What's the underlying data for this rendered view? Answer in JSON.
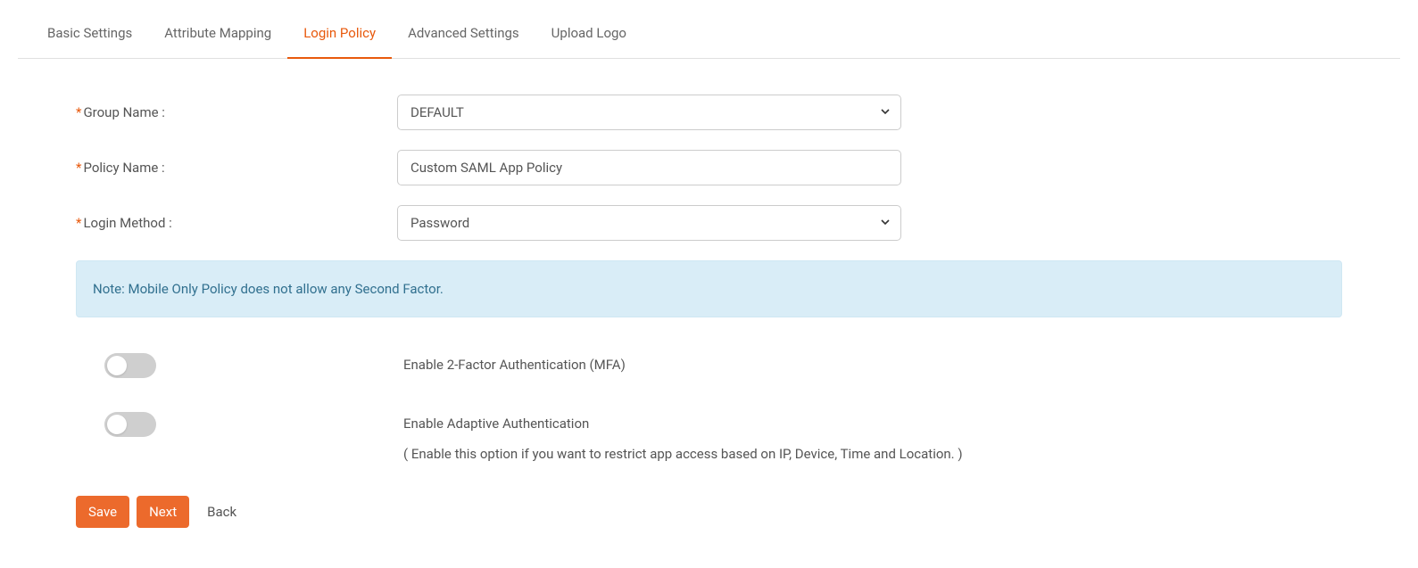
{
  "tabs": [
    {
      "label": "Basic Settings",
      "active": false
    },
    {
      "label": "Attribute Mapping",
      "active": false
    },
    {
      "label": "Login Policy",
      "active": true
    },
    {
      "label": "Advanced Settings",
      "active": false
    },
    {
      "label": "Upload Logo",
      "active": false
    }
  ],
  "form": {
    "group_name": {
      "label": "Group Name :",
      "value": "DEFAULT"
    },
    "policy_name": {
      "label": "Policy Name :",
      "value": "Custom SAML App Policy"
    },
    "login_method": {
      "label": "Login Method :",
      "value": "Password"
    }
  },
  "note": "Note: Mobile Only Policy does not allow any Second Factor.",
  "toggles": {
    "mfa": {
      "label": "Enable 2-Factor Authentication (MFA)"
    },
    "adaptive": {
      "label": "Enable Adaptive Authentication",
      "sublabel": "( Enable this option if you want to restrict app access based on IP, Device, Time and Location. )"
    }
  },
  "buttons": {
    "save": "Save",
    "next": "Next",
    "back": "Back"
  }
}
